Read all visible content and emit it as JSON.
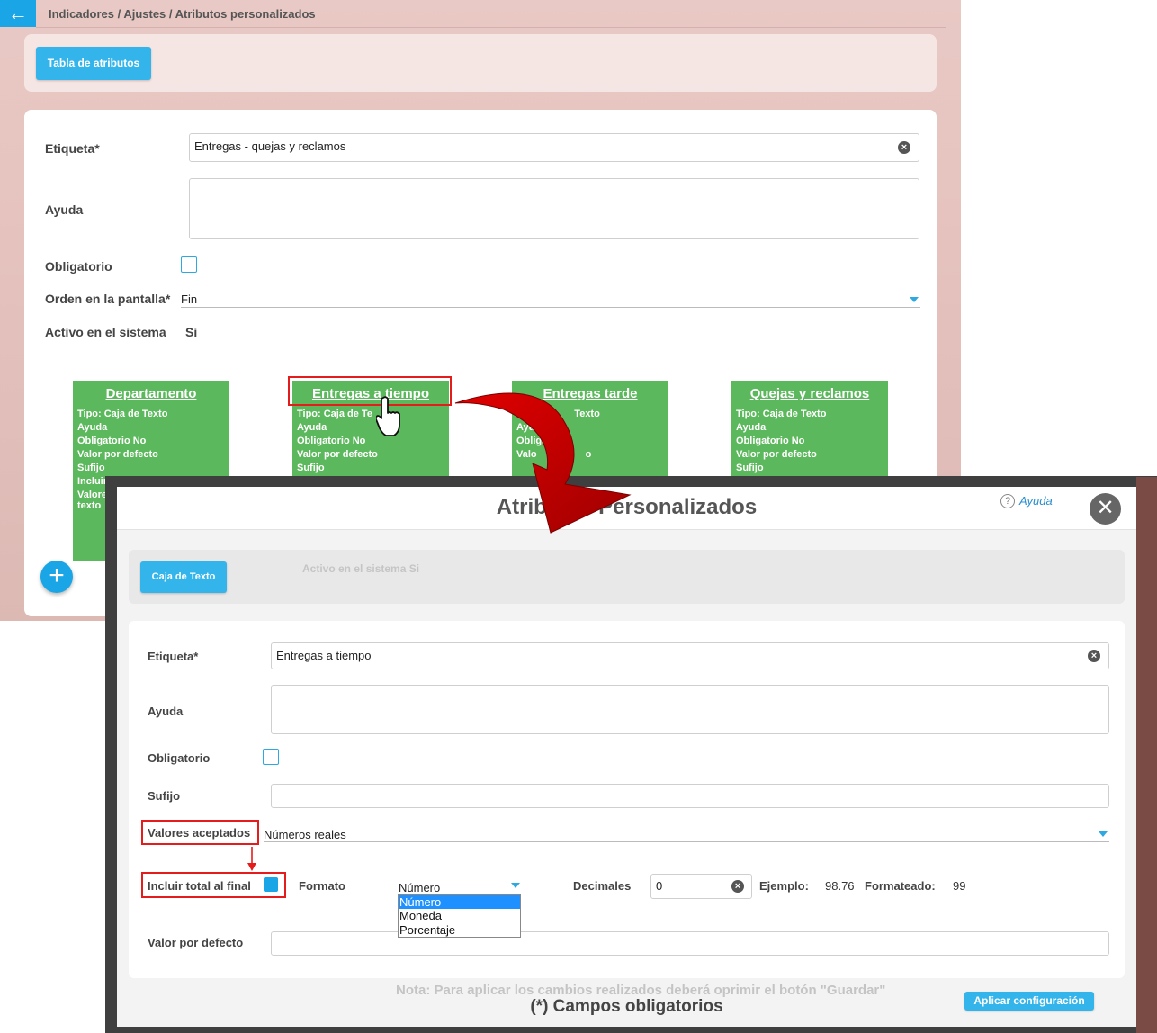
{
  "background": {
    "breadcrumb": "Indicadores / Ajustes / Atributos personalizados",
    "table_button": "Tabla de atributos",
    "form": {
      "label_label": "Etiqueta*",
      "label_value": "Entregas - quejas y reclamos",
      "help_label": "Ayuda",
      "required_label": "Obligatorio",
      "order_label": "Orden en la pantalla*",
      "order_value": "Fin",
      "active_label": "Activo en el sistema",
      "active_value": "Si"
    },
    "cards": [
      {
        "title": "Departamento",
        "lines": [
          "Tipo: Caja de Texto",
          "Ayuda",
          "Obligatorio No",
          "Valor por defecto",
          "Sufijo",
          "Incluir",
          "Valores",
          "texto"
        ]
      },
      {
        "title": "Entregas a tiempo",
        "lines": [
          "Tipo: Caja de Te",
          "Ayuda",
          "Obligatorio No",
          "Valor por defecto",
          "Sufijo"
        ]
      },
      {
        "title": "Entregas tarde",
        "lines": [
          "Tip",
          "Texto",
          "Ayuda",
          "Obligato",
          "Valo",
          "o"
        ]
      },
      {
        "title": "Quejas y reclamos",
        "lines": [
          "Tipo: Caja de Texto",
          "Ayuda",
          "Obligatorio No",
          "Valor por defecto",
          "Sufijo"
        ]
      }
    ],
    "fab": "+"
  },
  "modal": {
    "title": "Atributos Personalizados",
    "help": "Ayuda",
    "close": "✕",
    "type_button": "Caja de Texto",
    "ghost_text": "Activo en el sistema   Si",
    "fields": {
      "label_label": "Etiqueta*",
      "label_value": "Entregas a tiempo",
      "help_label": "Ayuda",
      "required_label": "Obligatorio",
      "suffix_label": "Sufijo",
      "accepted_label": "Valores aceptados",
      "accepted_value": "Números reales",
      "include_total_label": "Incluir total al final",
      "format_label": "Formato",
      "format_value": "Número",
      "format_options": [
        "Número",
        "Moneda",
        "Porcentaje"
      ],
      "decimals_label": "Decimales",
      "decimals_value": "0",
      "example_label": "Ejemplo:",
      "example_value": "98.76",
      "formatted_label": "Formateado:",
      "formatted_value": "99",
      "default_label": "Valor por defecto"
    },
    "required_note": "(*) Campos obligatorios",
    "apply_button": "Aplicar configuración",
    "ghost_note": "Nota: Para aplicar los cambios realizados deberá oprimir el botón \"Guardar\""
  },
  "colors": {
    "accent": "#33b5ec",
    "card_green": "#5cb85c",
    "highlight_red": "#e41c1c",
    "arrow_red": "#cc0000"
  }
}
